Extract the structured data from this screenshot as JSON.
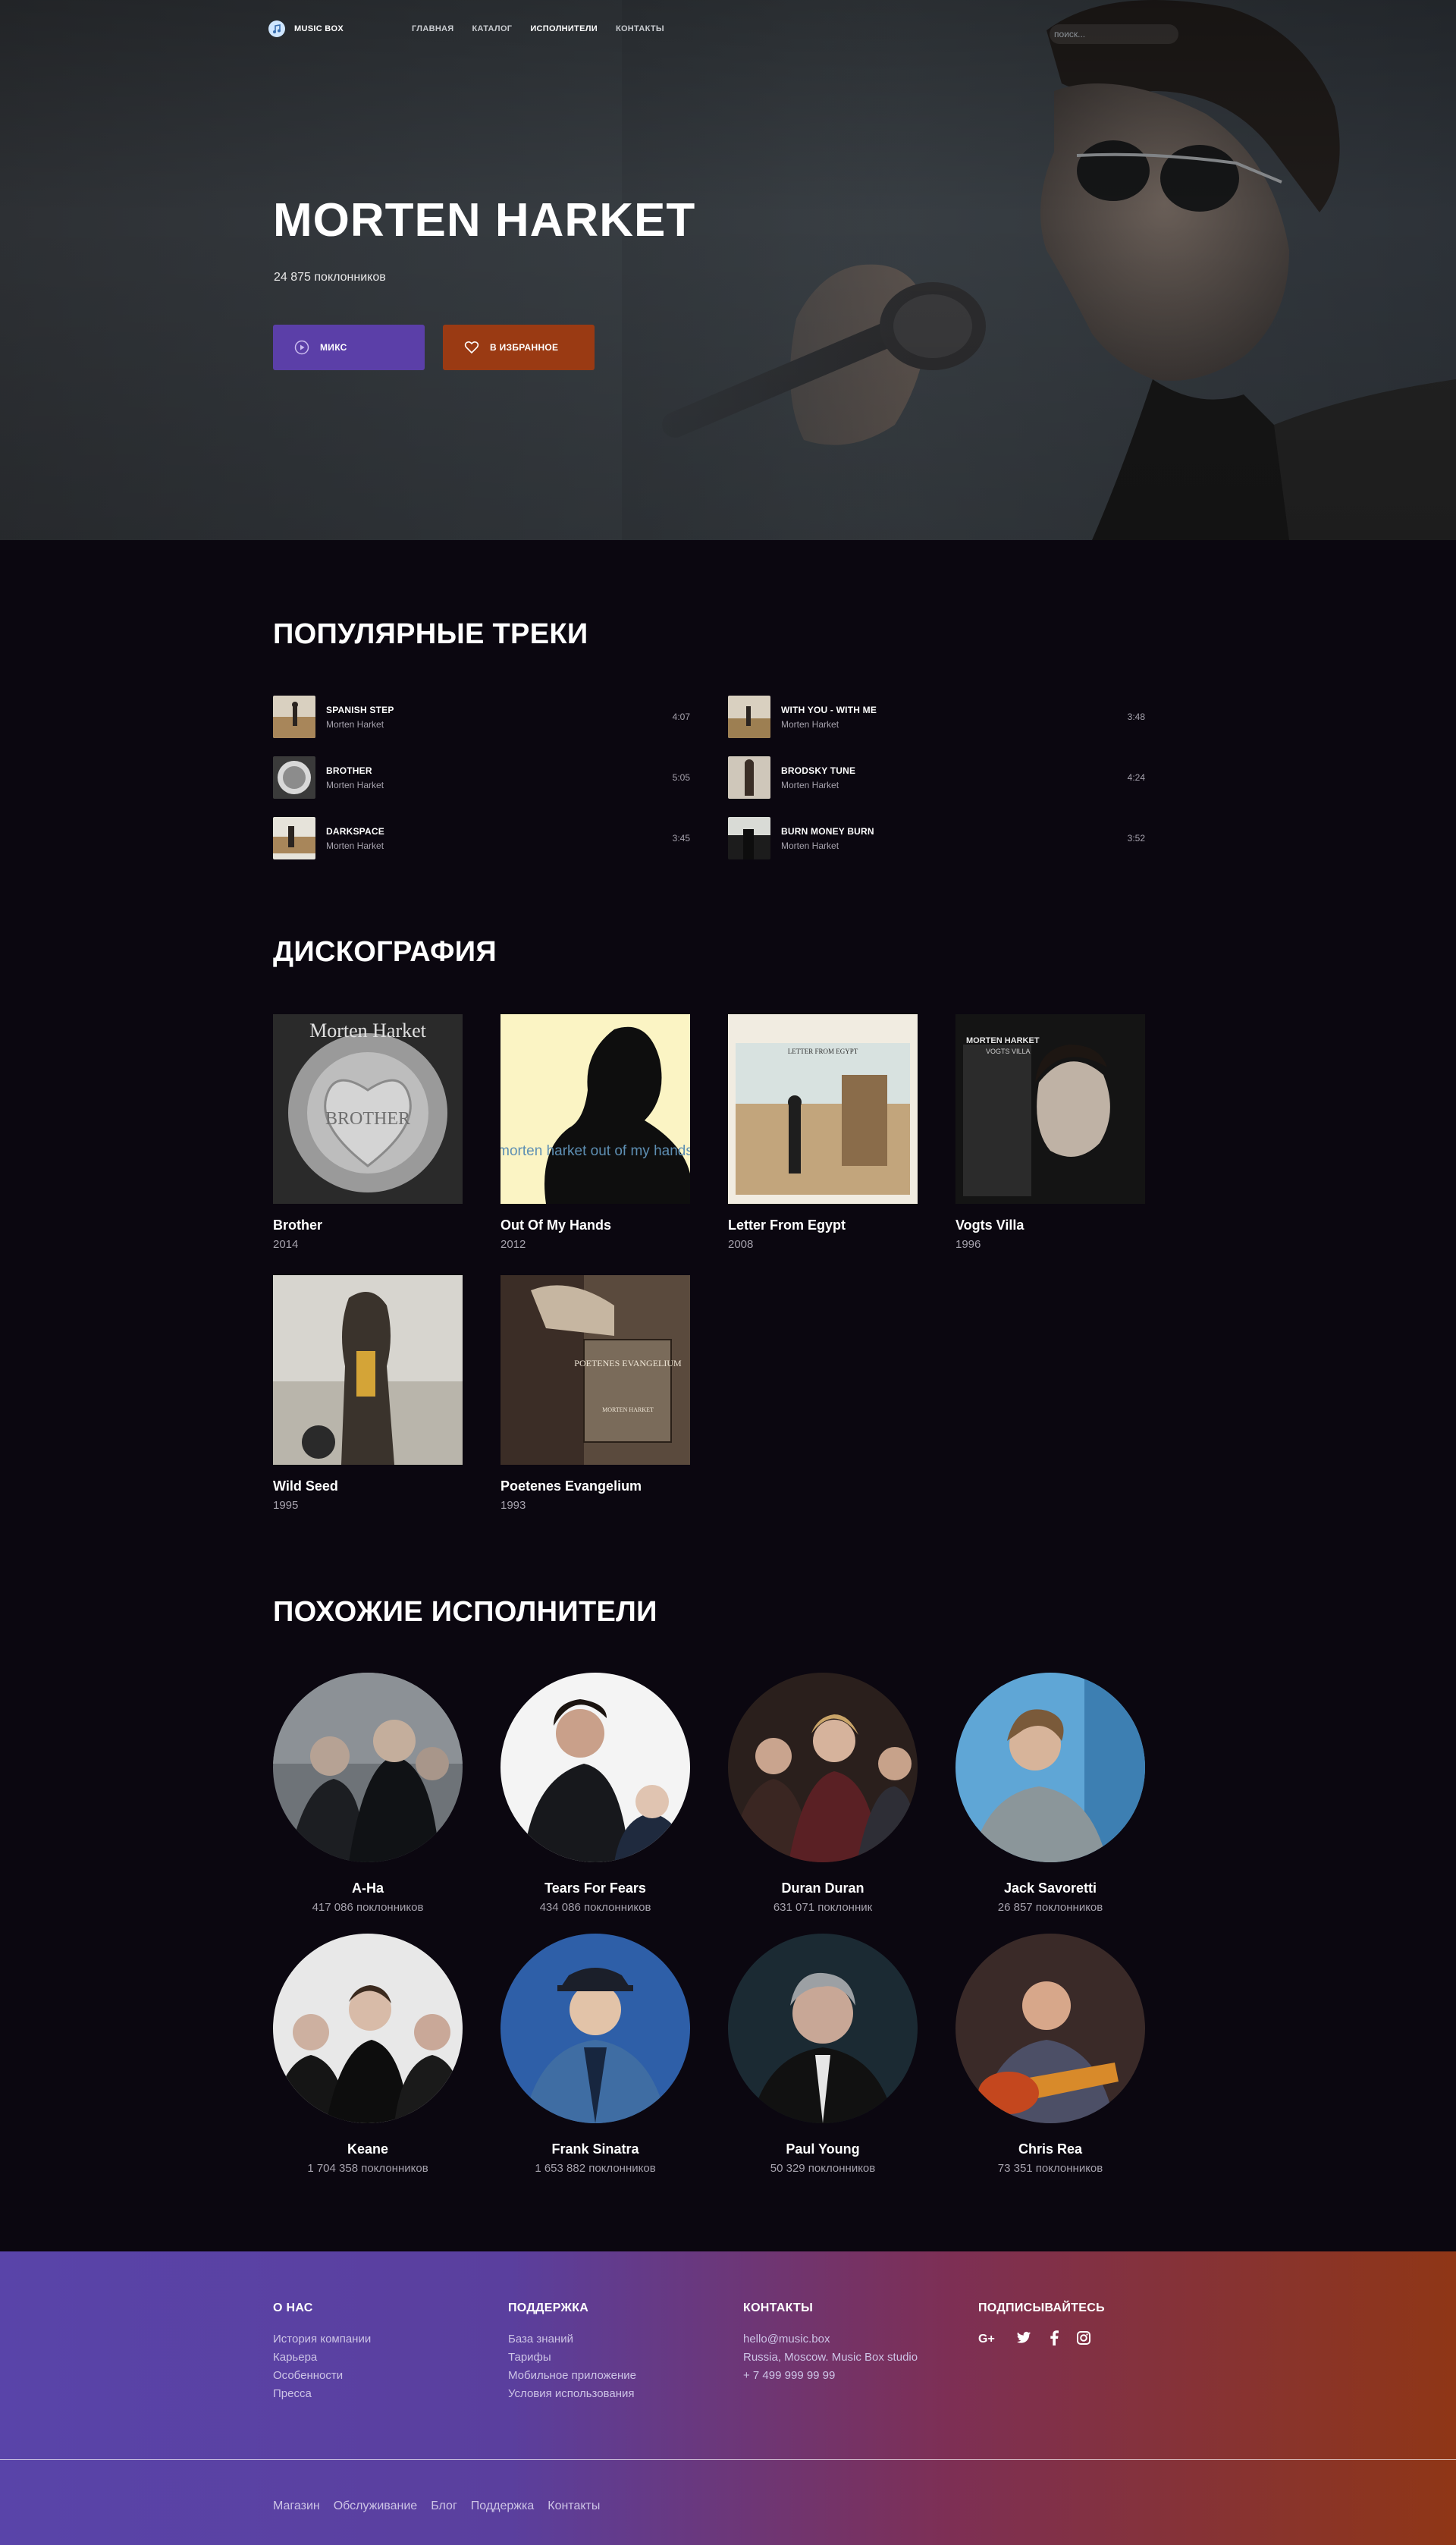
{
  "header": {
    "logo_text": "MUSIC BOX",
    "nav": [
      "ГЛАВНАЯ",
      "КАТАЛОГ",
      "ИСПОЛНИТЕЛИ",
      "КОНТАКТЫ"
    ],
    "active_nav": "ИСПОЛНИТЕЛИ",
    "search_placeholder": "поиск..."
  },
  "hero": {
    "artist": "MORTEN HARKET",
    "followers": "24 875 поклонников",
    "mix_label": "МИКС",
    "favorite_label": "В ИЗБРАННОЕ"
  },
  "popular": {
    "title": "ПОПУЛЯРНЫЕ ТРЕКИ",
    "tracks": [
      {
        "name": "SPANISH STEP",
        "artist": "Morten Harket",
        "time": "4:07"
      },
      {
        "name": "BROTHER",
        "artist": "Morten Harket",
        "time": "5:05"
      },
      {
        "name": "DARKSPACE",
        "artist": "Morten Harket",
        "time": "3:45"
      },
      {
        "name": "WITH YOU - WITH ME",
        "artist": "Morten Harket",
        "time": "3:48"
      },
      {
        "name": "BRODSKY TUNE",
        "artist": "Morten Harket",
        "time": "4:24"
      },
      {
        "name": "BURN MONEY BURN",
        "artist": "Morten Harket",
        "time": "3:52"
      }
    ]
  },
  "discography": {
    "title": "ДИСКОГРАФИЯ",
    "albums": [
      {
        "title": "Brother",
        "year": "2014",
        "cover_text": "Morten Harket",
        "cover_sub": "BROTHER"
      },
      {
        "title": "Out Of My Hands",
        "year": "2012",
        "cover_text": "morten harket out of my hands"
      },
      {
        "title": "Letter From Egypt",
        "year": "2008",
        "cover_text": "LETTER FROM EGYPT"
      },
      {
        "title": "Vogts Villa",
        "year": "1996",
        "cover_text": "MORTEN HARKET",
        "cover_sub": "VOGTS VILLA"
      },
      {
        "title": "Wild Seed",
        "year": "1995"
      },
      {
        "title": "Poetenes Evangelium",
        "year": "1993",
        "cover_text": "POETENES EVANGELIUM",
        "cover_sub": "MORTEN HARKET"
      }
    ]
  },
  "similar": {
    "title": "ПОХОЖИЕ ИСПОЛНИТЕЛИ",
    "artists": [
      {
        "name": "A-Ha",
        "fans": "417 086 поклонников"
      },
      {
        "name": "Tears For Fears",
        "fans": "434 086 поклонников"
      },
      {
        "name": "Duran Duran",
        "fans": "631 071 поклонник"
      },
      {
        "name": "Jack Savoretti",
        "fans": "26 857 поклонников"
      },
      {
        "name": "Keane",
        "fans": "1 704 358 поклонников"
      },
      {
        "name": "Frank Sinatra",
        "fans": "1 653 882 поклонников"
      },
      {
        "name": "Paul Young",
        "fans": "50 329 поклонников"
      },
      {
        "name": "Chris Rea",
        "fans": "73 351 поклонников"
      }
    ]
  },
  "footer": {
    "about": {
      "title": "О НАС",
      "links": [
        "История компании",
        "Карьера",
        "Особенности",
        "Пресса"
      ]
    },
    "support": {
      "title": "ПОДДЕРЖКА",
      "links": [
        "База знаний",
        "Тарифы",
        "Мобильное приложение",
        "Условия использования"
      ]
    },
    "contacts": {
      "title": "КОНТАКТЫ",
      "lines": [
        "hello@music.box",
        "Russia, Moscow. Music Box studio",
        "+ 7 499 999 99 99"
      ]
    },
    "subscribe": {
      "title": "ПОДПИСЫВАЙТЕСЬ",
      "icons": [
        "google-plus-icon",
        "twitter-icon",
        "facebook-icon",
        "instagram-icon"
      ]
    },
    "bottom_links": [
      "Магазин",
      "Обслуживание",
      "Блог",
      "Поддержка",
      "Контакты"
    ]
  },
  "colors": {
    "accent_purple": "#5b3fa8",
    "accent_orange": "#9a3a13",
    "page_bg": "#0b0710"
  }
}
